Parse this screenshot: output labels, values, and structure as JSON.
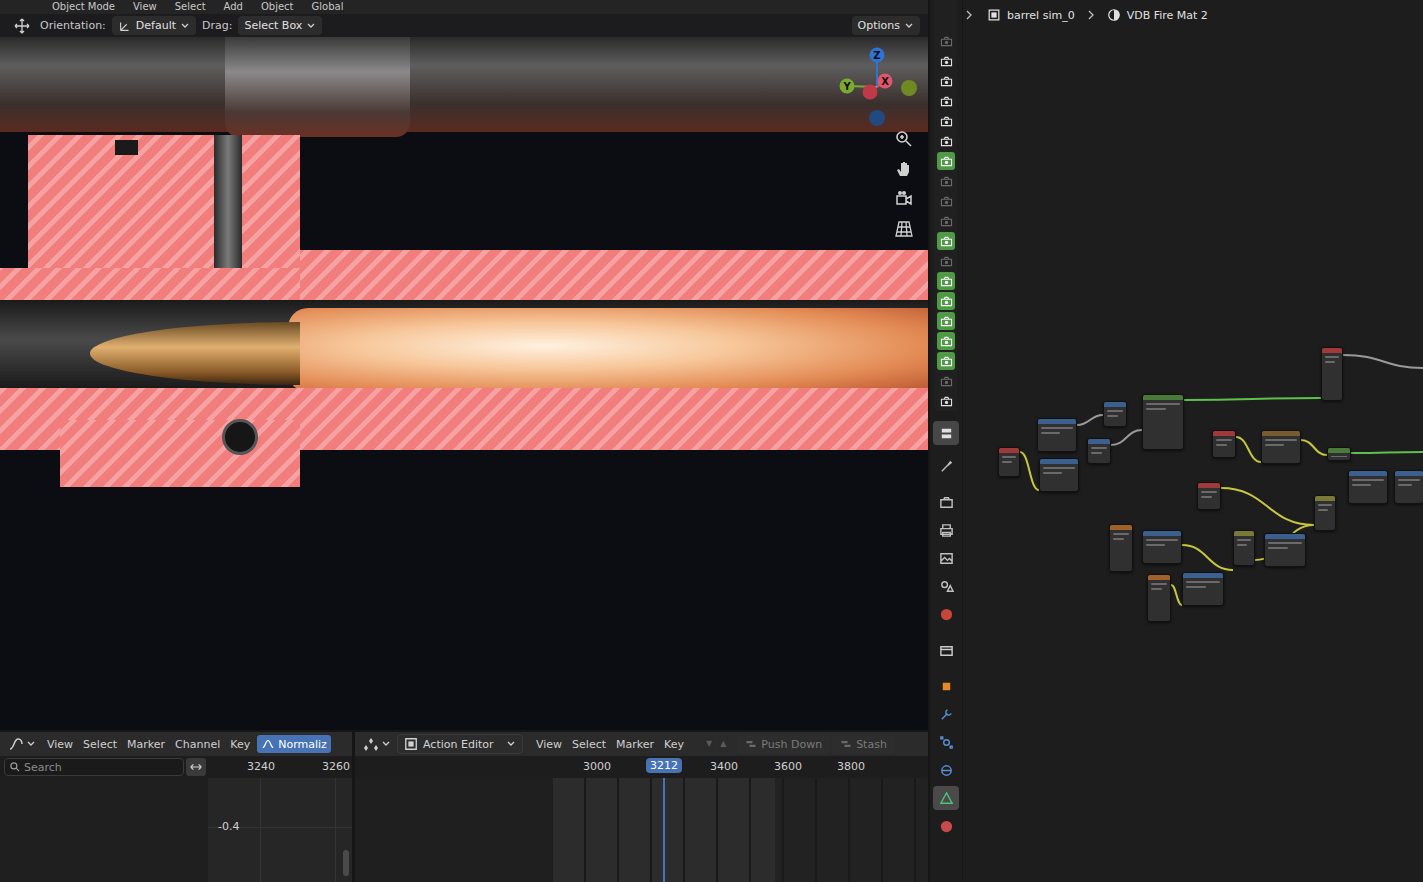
{
  "top_header": {
    "items": [
      "Object Mode",
      "View",
      "Select",
      "Add",
      "Object",
      "Global"
    ]
  },
  "tool_settings": {
    "orientation_label": "Orientation:",
    "orientation": "Default",
    "drag_label": "Drag:",
    "drag": "Select Box",
    "options": "Options"
  },
  "gizmo": {
    "axes": [
      {
        "label": "Z",
        "color": "#2f73d6"
      },
      {
        "label": "Y",
        "color": "#7bab2e"
      },
      {
        "label": "X",
        "color": "#e0566a"
      }
    ]
  },
  "outliner_toggles": [
    {
      "on": false,
      "selected": false
    },
    {
      "on": true,
      "selected": false
    },
    {
      "on": true,
      "selected": false
    },
    {
      "on": true,
      "selected": false
    },
    {
      "on": true,
      "selected": false
    },
    {
      "on": true,
      "selected": false
    },
    {
      "on": true,
      "selected": true
    },
    {
      "on": false,
      "selected": false
    },
    {
      "on": false,
      "selected": false
    },
    {
      "on": false,
      "selected": false
    },
    {
      "on": true,
      "selected": true
    },
    {
      "on": false,
      "selected": false
    },
    {
      "on": true,
      "selected": true
    },
    {
      "on": true,
      "selected": true
    },
    {
      "on": true,
      "selected": true
    },
    {
      "on": true,
      "selected": true
    },
    {
      "on": true,
      "selected": true
    },
    {
      "on": false,
      "selected": false
    },
    {
      "on": true,
      "selected": false
    }
  ],
  "properties_tabs": [
    {
      "kind": "tool-settings",
      "selected": false
    },
    {
      "kind": "tool",
      "selected": false
    },
    {
      "kind": "render",
      "selected": false
    },
    {
      "kind": "output",
      "selected": false
    },
    {
      "kind": "view-layer",
      "selected": false
    },
    {
      "kind": "scene",
      "selected": false
    },
    {
      "kind": "world",
      "selected": false
    },
    {
      "kind": "collection",
      "selected": false
    },
    {
      "kind": "object",
      "selected": false
    },
    {
      "kind": "modifier",
      "selected": false
    },
    {
      "kind": "particles",
      "selected": false
    },
    {
      "kind": "physics",
      "selected": false
    },
    {
      "kind": "data",
      "selected": true
    },
    {
      "kind": "material",
      "selected": false
    }
  ],
  "breadcrumb": {
    "object": "barrel sim_0",
    "material": "VDB Fire Mat 2"
  },
  "nodes": [
    {
      "color": "#a03a3a"
    },
    {
      "color": "#3b5f8f"
    },
    {
      "color": "#3b5f8f"
    },
    {
      "color": "#3b5f8f"
    },
    {
      "color": "#3b5f8f"
    },
    {
      "color": "#4a7a3a"
    },
    {
      "color": "#a03a3a"
    },
    {
      "color": "#7a5a30"
    },
    {
      "color": "#a03a3a"
    },
    {
      "color": "#4a7a3a"
    },
    {
      "color": "#3b5f8f"
    },
    {
      "color": "#3b5f8f"
    },
    {
      "color": "#a03a3a"
    },
    {
      "color": "#7a7a36"
    },
    {
      "color": "#a0622a"
    },
    {
      "color": "#3b5f8f"
    },
    {
      "color": "#7a7a36"
    },
    {
      "color": "#3b5f8f"
    },
    {
      "color": "#a0622a"
    },
    {
      "color": "#3b5f8f"
    }
  ],
  "links": [
    {
      "color": "#9a9a9a"
    },
    {
      "color": "#5fbf4f"
    },
    {
      "color": "#5fbf4f"
    },
    {
      "color": "#c8c83e"
    },
    {
      "color": "#c8c83e"
    },
    {
      "color": "#c8c83e"
    },
    {
      "color": "#c8c83e"
    },
    {
      "color": "#c8c83e"
    },
    {
      "color": "#c8c83e"
    },
    {
      "color": "#9a9a9a"
    },
    {
      "color": "#9a9a9a"
    },
    {
      "color": "#c8c83e"
    }
  ],
  "graph_editor": {
    "menus": [
      "View",
      "Select",
      "Marker",
      "Channel",
      "Key"
    ],
    "normalize": {
      "label": "Normaliz",
      "selected": true
    },
    "search": {
      "placeholder": "Search"
    },
    "ruler": [
      "3240",
      "3260"
    ],
    "value_label": "-0.4"
  },
  "action_editor": {
    "mode": "Action Editor",
    "menus": [
      "View",
      "Select",
      "Marker",
      "Key"
    ],
    "layer_buttons": [
      {
        "symbol": "▼",
        "disabled": true
      },
      {
        "symbol": "▲",
        "disabled": true
      }
    ],
    "buttons": [
      {
        "label": "Push Down",
        "disabled": true
      },
      {
        "label": "Stash",
        "disabled": true
      }
    ],
    "ruler": [
      "3000",
      "3400",
      "3600",
      "3800"
    ],
    "current_frame": "3212"
  }
}
